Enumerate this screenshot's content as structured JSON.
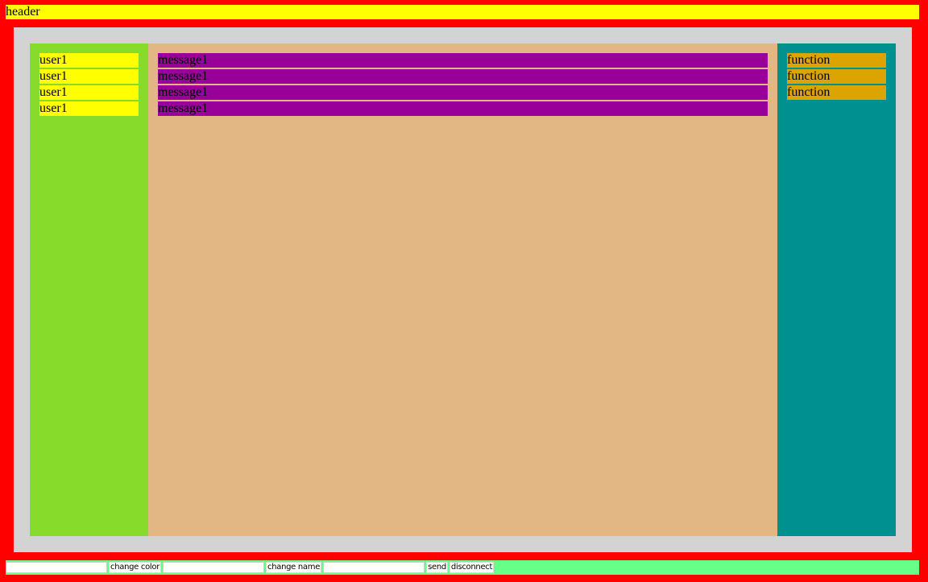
{
  "header": {
    "title": "header"
  },
  "users": [
    "user1",
    "user1",
    "user1",
    "user1"
  ],
  "messages": [
    "message1",
    "message1",
    "message1",
    "message1"
  ],
  "functions": [
    "function",
    "function",
    "function"
  ],
  "footer": {
    "color_input": {
      "value": "",
      "placeholder": ""
    },
    "change_color_label": "change color",
    "name_input": {
      "value": "",
      "placeholder": ""
    },
    "change_name_label": "change name",
    "message_input": {
      "value": "",
      "placeholder": ""
    },
    "send_label": "send",
    "disconnect_label": "disconnect"
  },
  "colors": {
    "page_background": "#ff0000",
    "header": "#ffff00",
    "container": "#d3d3d3",
    "users_panel": "#87dc2b",
    "user_item": "#ffff00",
    "messages_panel": "#e3b784",
    "message_item": "#990099",
    "functions_panel": "#009090",
    "function_item": "#dca400",
    "footer": "#66ff88"
  }
}
